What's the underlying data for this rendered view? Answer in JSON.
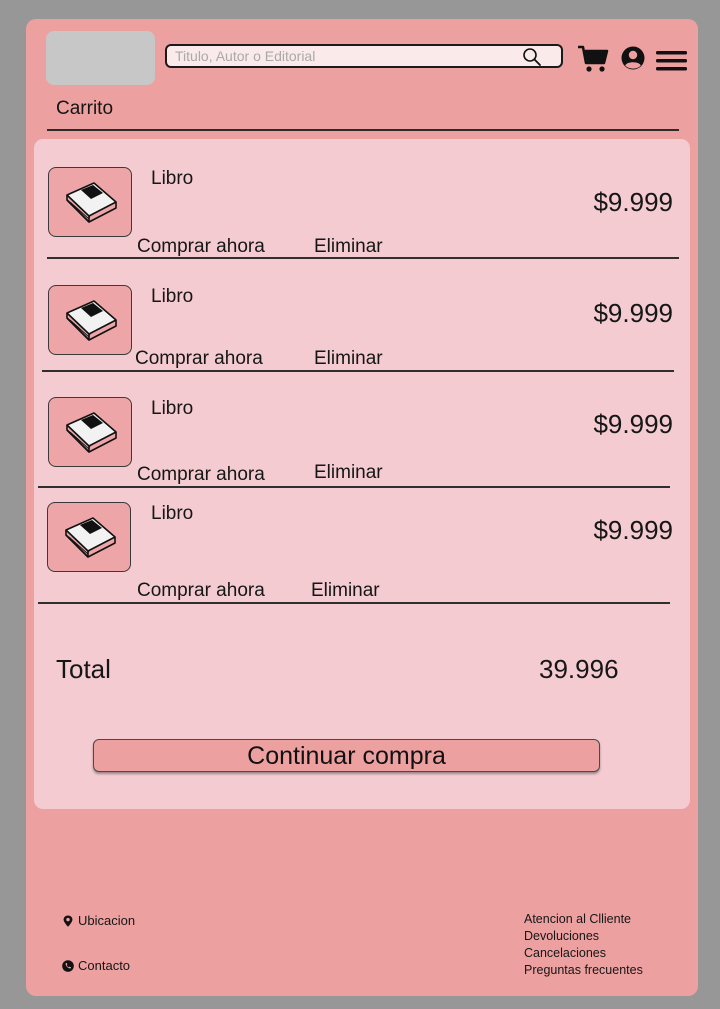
{
  "header": {
    "search_placeholder": "Titulo, Autor o Editorial",
    "icons": [
      "search-icon",
      "cart-icon",
      "user-circle-icon",
      "hamburger-menu-icon"
    ]
  },
  "page_title": "Carrito",
  "cart": {
    "items": [
      {
        "name": "Libro",
        "price": "$9.999",
        "buy_label": "Comprar ahora",
        "remove_label": "Eliminar",
        "icon": "book-icon"
      },
      {
        "name": "Libro",
        "price": "$9.999",
        "buy_label": "Comprar ahora",
        "remove_label": "Eliminar",
        "icon": "book-icon"
      },
      {
        "name": "Libro",
        "price": "$9.999",
        "buy_label": "Comprar ahora",
        "remove_label": "Eliminar",
        "icon": "book-icon"
      },
      {
        "name": "Libro",
        "price": "$9.999",
        "buy_label": "Comprar ahora",
        "remove_label": "Eliminar",
        "icon": "book-icon"
      }
    ],
    "total_label": "Total",
    "total_value": "39.996",
    "continue_label": "Continuar compra"
  },
  "footer": {
    "location_label": "Ubicacion",
    "contact_label": "Contacto",
    "links": [
      "Atencion al Clliente",
      "Devoluciones",
      "Cancelaciones",
      "Preguntas frecuentes"
    ]
  },
  "colors": {
    "background": "#979797",
    "frame": "#eda0a0",
    "panel": "#f3cbd1",
    "logo_placeholder": "#c7c7c7"
  }
}
